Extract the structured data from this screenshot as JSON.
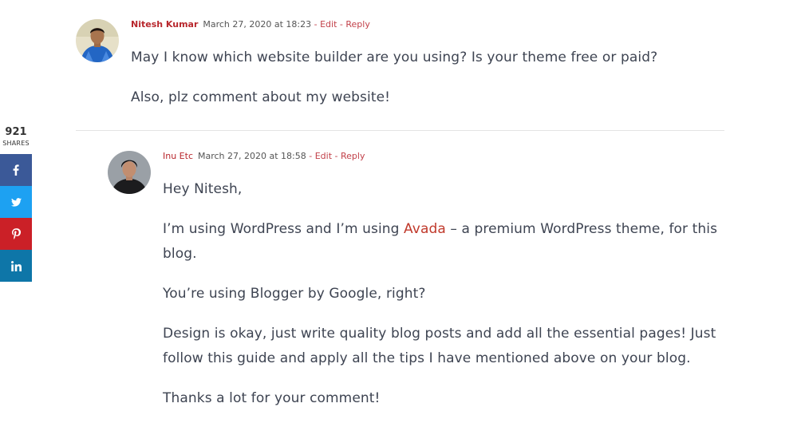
{
  "share": {
    "count": "921",
    "label": "SHARES",
    "buttons": [
      {
        "icon": "facebook-icon",
        "color": "#3b5998"
      },
      {
        "icon": "twitter-icon",
        "color": "#1da1f2"
      },
      {
        "icon": "pinterest-icon",
        "color": "#cb2027"
      },
      {
        "icon": "linkedin-icon",
        "color": "#0e76a8"
      }
    ]
  },
  "comments": [
    {
      "author": "Nitesh Kumar",
      "date": "March 27, 2020 at 18:23",
      "dash": " - ",
      "edit": "Edit",
      "reply": "Reply",
      "paragraphs": [
        "May I know which website builder are you using? Is your theme free or paid?",
        "Also, plz comment about my website!"
      ]
    },
    {
      "author": "Inu Etc",
      "date": "March 27, 2020 at 18:58",
      "dash": " - ",
      "edit": "Edit",
      "reply": "Reply",
      "p1": "Hey Nitesh,",
      "p2_before": "I’m using WordPress and I’m using ",
      "p2_link": "Avada",
      "p2_after": " – a premium WordPress theme, for this blog.",
      "p3": "You’re using Blogger by Google, right?",
      "p4": "Design is okay, just write quality blog posts and add all the essential pages! Just follow this guide and apply all the tips I have mentioned above on your blog.",
      "p5": "Thanks a lot for your comment!"
    }
  ]
}
